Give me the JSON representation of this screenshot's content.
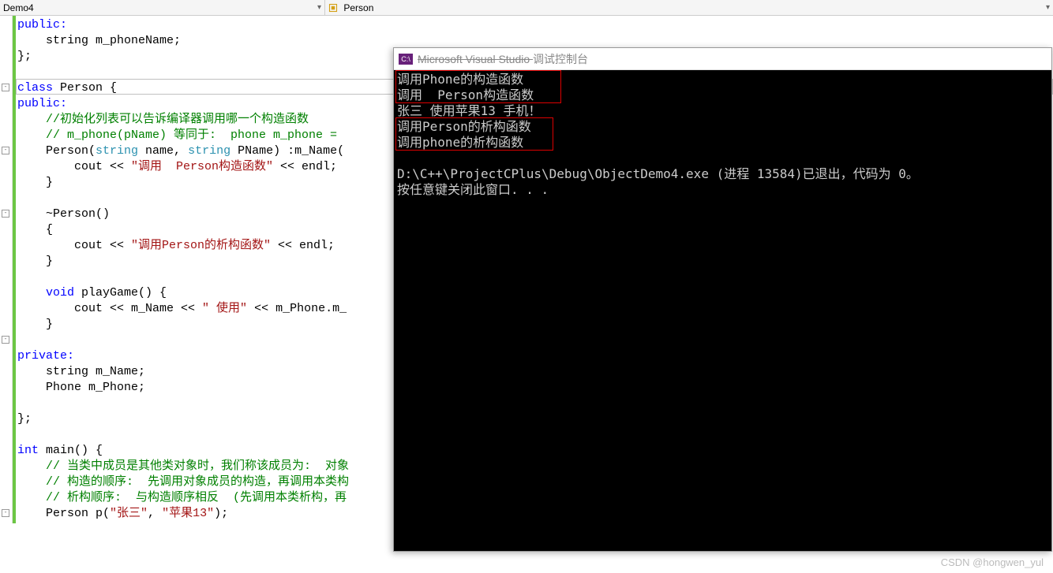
{
  "topbar": {
    "left_label": "Demo4",
    "right_label": "Person"
  },
  "code": {
    "l1": "public:",
    "l2": "    string m_phoneName;",
    "l3": "};",
    "l4": "",
    "l5a": "class",
    "l5b": " Person {",
    "l6": "public:",
    "l7": "    //初始化列表可以告诉编译器调用哪一个构造函数",
    "l8": "    // m_phone(pName) 等同于:  phone m_phone = ",
    "l9a": "    Person(",
    "l9b": "string",
    "l9c": " name, ",
    "l9d": "string",
    "l9e": " PName) :m_Name(",
    "l10a": "        cout << ",
    "l10b": "\"调用  Person构造函数\"",
    "l10c": " << endl;",
    "l11": "    }",
    "l12": "",
    "l13": "    ~Person()",
    "l14": "    {",
    "l15a": "        cout << ",
    "l15b": "\"调用Person的析构函数\"",
    "l15c": " << endl;",
    "l16": "    }",
    "l17": "",
    "l18a": "    ",
    "l18b": "void",
    "l18c": " playGame() {",
    "l19a": "        cout << m_Name << ",
    "l19b": "\" 使用\"",
    "l19c": " << m_Phone.m_",
    "l20": "    }",
    "l21": "",
    "l22": "private:",
    "l23": "    string m_Name;",
    "l24": "    Phone m_Phone;",
    "l25": "",
    "l26": "};",
    "l27": "",
    "l28a": "int",
    "l28b": " main() {",
    "l29": "    // 当类中成员是其他类对象时，我们称该成员为:  对象",
    "l30": "    // 构造的顺序:  先调用对象成员的构造，再调用本类构",
    "l31": "    // 析构顺序:  与构造顺序相反  (先调用本类析构，再",
    "l32a": "    Person p(",
    "l32b": "\"张三\"",
    "l32c": ", ",
    "l32d": "\"苹果13\"",
    "l32e": ");"
  },
  "console": {
    "title_strike": "Microsoft Visual Studio ",
    "title_rest": "调试控制台",
    "icon_text": "C:\\",
    "l1": "调用Phone的构造函数",
    "l2": "调用  Person构造函数",
    "l3": "张三 使用苹果13 手机！",
    "l4": "调用Person的析构函数",
    "l5": "调用phone的析构函数",
    "l6": "",
    "l7": "D:\\C++\\ProjectCPlus\\Debug\\ObjectDemo4.exe (进程 13584)已退出，代码为 0。",
    "l8": "按任意键关闭此窗口. . ."
  },
  "watermark": "CSDN @hongwen_yul"
}
